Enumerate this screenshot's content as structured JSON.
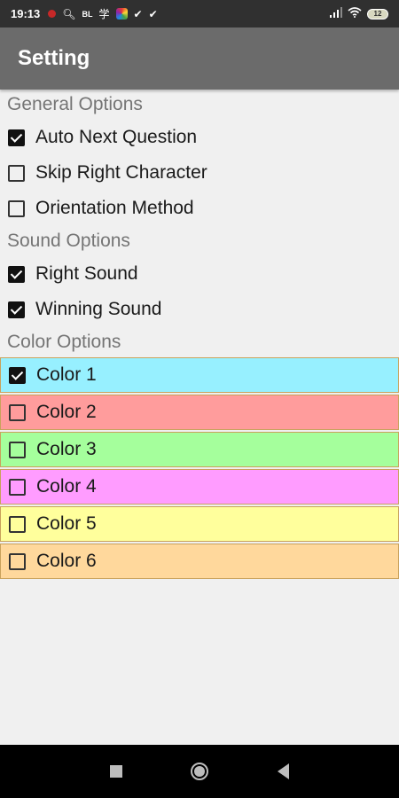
{
  "status_bar": {
    "time": "19:13",
    "badge_bl": "BL",
    "badge_cn": "学",
    "battery": "12"
  },
  "app_bar": {
    "title": "Setting"
  },
  "sections": {
    "general": {
      "header": "General Options",
      "options": [
        {
          "label": "Auto Next Question",
          "checked": true
        },
        {
          "label": "Skip Right Character",
          "checked": false
        },
        {
          "label": "Orientation Method",
          "checked": false
        }
      ]
    },
    "sound": {
      "header": "Sound Options",
      "options": [
        {
          "label": "Right Sound",
          "checked": true
        },
        {
          "label": "Winning Sound",
          "checked": true
        }
      ]
    },
    "color": {
      "header": "Color Options",
      "options": [
        {
          "label": "Color 1",
          "checked": true,
          "color": "#97f0ff"
        },
        {
          "label": "Color 2",
          "checked": false,
          "color": "#ff9c9c"
        },
        {
          "label": "Color 3",
          "checked": false,
          "color": "#a5ff9c"
        },
        {
          "label": "Color 4",
          "checked": false,
          "color": "#ff9cff"
        },
        {
          "label": "Color 5",
          "checked": false,
          "color": "#ffff9c"
        },
        {
          "label": "Color 6",
          "checked": false,
          "color": "#ffd89c"
        }
      ]
    }
  },
  "icons": [
    "notification-dot-icon",
    "search-icon",
    "colorful-app-icon",
    "check-icon",
    "signal-icon",
    "wifi-icon",
    "battery-icon"
  ]
}
